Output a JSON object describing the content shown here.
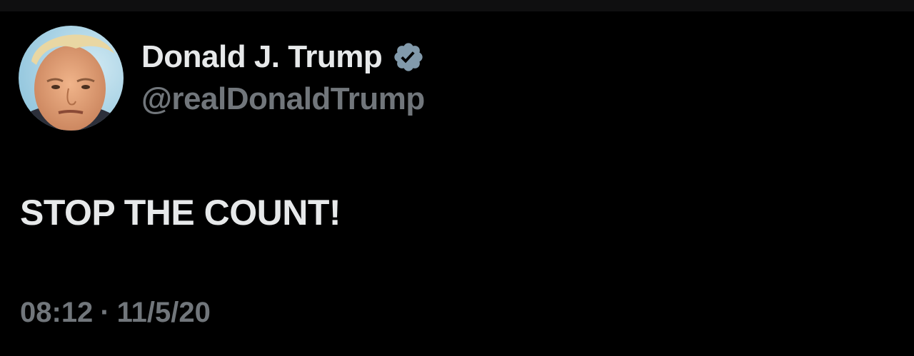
{
  "author": {
    "display_name": "Donald J. Trump",
    "handle": "@realDonaldTrump",
    "verified": true,
    "avatar_icon": "profile-photo"
  },
  "tweet": {
    "text": "STOP THE COUNT!",
    "time": "08:12",
    "separator": "·",
    "date": "11/5/20"
  },
  "colors": {
    "background": "#000000",
    "primary_text": "#e7e9ea",
    "secondary_text": "#71767b",
    "verified_badge": "#829aab"
  }
}
